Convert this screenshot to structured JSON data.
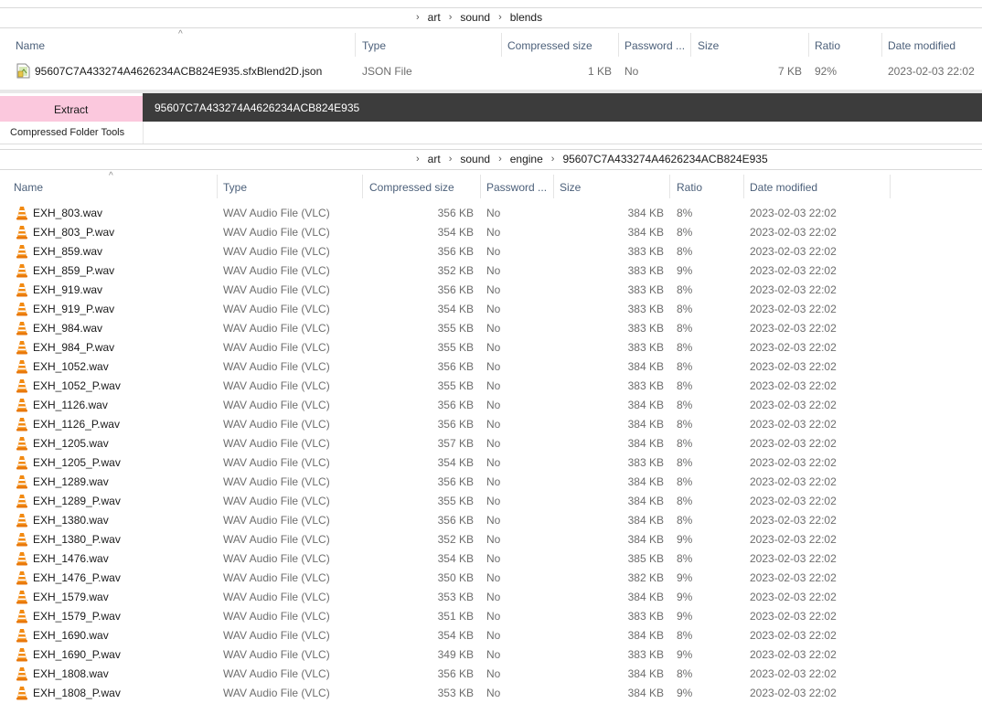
{
  "top_pane": {
    "breadcrumb": [
      "art",
      "sound",
      "blends"
    ],
    "columns": [
      "Name",
      "Type",
      "Compressed size",
      "Password ...",
      "Size",
      "Ratio",
      "Date modified"
    ],
    "file": {
      "name": "95607C7A433274A4626234ACB824E935.sfxBlend2D.json",
      "type": "JSON File",
      "compressed": "1 KB",
      "password": "No",
      "size": "7 KB",
      "ratio": "92%",
      "date": "2023-02-03 22:02",
      "icon": "json-file-icon"
    }
  },
  "ribbon": {
    "extract_tab": "Extract",
    "tools_label": "Compressed Folder Tools",
    "title": "95607C7A433274A4626234ACB824E935",
    "extract_color": "#fbc8dd",
    "title_bar_color": "#3c3c3c"
  },
  "bottom_pane": {
    "breadcrumb": [
      "art",
      "sound",
      "engine",
      "95607C7A433274A4626234ACB824E935"
    ],
    "columns": [
      "Name",
      "Type",
      "Compressed size",
      "Password ...",
      "Size",
      "Ratio",
      "Date modified"
    ],
    "file_icon": "vlc-cone-icon",
    "files": [
      {
        "name": "EXH_803.wav",
        "type": "WAV Audio File (VLC)",
        "compressed": "356 KB",
        "password": "No",
        "size": "384 KB",
        "ratio": "8%",
        "date": "2023-02-03 22:02"
      },
      {
        "name": "EXH_803_P.wav",
        "type": "WAV Audio File (VLC)",
        "compressed": "354 KB",
        "password": "No",
        "size": "384 KB",
        "ratio": "8%",
        "date": "2023-02-03 22:02"
      },
      {
        "name": "EXH_859.wav",
        "type": "WAV Audio File (VLC)",
        "compressed": "356 KB",
        "password": "No",
        "size": "383 KB",
        "ratio": "8%",
        "date": "2023-02-03 22:02"
      },
      {
        "name": "EXH_859_P.wav",
        "type": "WAV Audio File (VLC)",
        "compressed": "352 KB",
        "password": "No",
        "size": "383 KB",
        "ratio": "9%",
        "date": "2023-02-03 22:02"
      },
      {
        "name": "EXH_919.wav",
        "type": "WAV Audio File (VLC)",
        "compressed": "356 KB",
        "password": "No",
        "size": "383 KB",
        "ratio": "8%",
        "date": "2023-02-03 22:02"
      },
      {
        "name": "EXH_919_P.wav",
        "type": "WAV Audio File (VLC)",
        "compressed": "354 KB",
        "password": "No",
        "size": "383 KB",
        "ratio": "8%",
        "date": "2023-02-03 22:02"
      },
      {
        "name": "EXH_984.wav",
        "type": "WAV Audio File (VLC)",
        "compressed": "355 KB",
        "password": "No",
        "size": "383 KB",
        "ratio": "8%",
        "date": "2023-02-03 22:02"
      },
      {
        "name": "EXH_984_P.wav",
        "type": "WAV Audio File (VLC)",
        "compressed": "355 KB",
        "password": "No",
        "size": "383 KB",
        "ratio": "8%",
        "date": "2023-02-03 22:02"
      },
      {
        "name": "EXH_1052.wav",
        "type": "WAV Audio File (VLC)",
        "compressed": "356 KB",
        "password": "No",
        "size": "384 KB",
        "ratio": "8%",
        "date": "2023-02-03 22:02"
      },
      {
        "name": "EXH_1052_P.wav",
        "type": "WAV Audio File (VLC)",
        "compressed": "355 KB",
        "password": "No",
        "size": "383 KB",
        "ratio": "8%",
        "date": "2023-02-03 22:02"
      },
      {
        "name": "EXH_1126.wav",
        "type": "WAV Audio File (VLC)",
        "compressed": "356 KB",
        "password": "No",
        "size": "384 KB",
        "ratio": "8%",
        "date": "2023-02-03 22:02"
      },
      {
        "name": "EXH_1126_P.wav",
        "type": "WAV Audio File (VLC)",
        "compressed": "356 KB",
        "password": "No",
        "size": "384 KB",
        "ratio": "8%",
        "date": "2023-02-03 22:02"
      },
      {
        "name": "EXH_1205.wav",
        "type": "WAV Audio File (VLC)",
        "compressed": "357 KB",
        "password": "No",
        "size": "384 KB",
        "ratio": "8%",
        "date": "2023-02-03 22:02"
      },
      {
        "name": "EXH_1205_P.wav",
        "type": "WAV Audio File (VLC)",
        "compressed": "354 KB",
        "password": "No",
        "size": "383 KB",
        "ratio": "8%",
        "date": "2023-02-03 22:02"
      },
      {
        "name": "EXH_1289.wav",
        "type": "WAV Audio File (VLC)",
        "compressed": "356 KB",
        "password": "No",
        "size": "384 KB",
        "ratio": "8%",
        "date": "2023-02-03 22:02"
      },
      {
        "name": "EXH_1289_P.wav",
        "type": "WAV Audio File (VLC)",
        "compressed": "355 KB",
        "password": "No",
        "size": "384 KB",
        "ratio": "8%",
        "date": "2023-02-03 22:02"
      },
      {
        "name": "EXH_1380.wav",
        "type": "WAV Audio File (VLC)",
        "compressed": "356 KB",
        "password": "No",
        "size": "384 KB",
        "ratio": "8%",
        "date": "2023-02-03 22:02"
      },
      {
        "name": "EXH_1380_P.wav",
        "type": "WAV Audio File (VLC)",
        "compressed": "352 KB",
        "password": "No",
        "size": "384 KB",
        "ratio": "9%",
        "date": "2023-02-03 22:02"
      },
      {
        "name": "EXH_1476.wav",
        "type": "WAV Audio File (VLC)",
        "compressed": "354 KB",
        "password": "No",
        "size": "385 KB",
        "ratio": "8%",
        "date": "2023-02-03 22:02"
      },
      {
        "name": "EXH_1476_P.wav",
        "type": "WAV Audio File (VLC)",
        "compressed": "350 KB",
        "password": "No",
        "size": "382 KB",
        "ratio": "9%",
        "date": "2023-02-03 22:02"
      },
      {
        "name": "EXH_1579.wav",
        "type": "WAV Audio File (VLC)",
        "compressed": "353 KB",
        "password": "No",
        "size": "384 KB",
        "ratio": "9%",
        "date": "2023-02-03 22:02"
      },
      {
        "name": "EXH_1579_P.wav",
        "type": "WAV Audio File (VLC)",
        "compressed": "351 KB",
        "password": "No",
        "size": "383 KB",
        "ratio": "9%",
        "date": "2023-02-03 22:02"
      },
      {
        "name": "EXH_1690.wav",
        "type": "WAV Audio File (VLC)",
        "compressed": "354 KB",
        "password": "No",
        "size": "384 KB",
        "ratio": "8%",
        "date": "2023-02-03 22:02"
      },
      {
        "name": "EXH_1690_P.wav",
        "type": "WAV Audio File (VLC)",
        "compressed": "349 KB",
        "password": "No",
        "size": "383 KB",
        "ratio": "9%",
        "date": "2023-02-03 22:02"
      },
      {
        "name": "EXH_1808.wav",
        "type": "WAV Audio File (VLC)",
        "compressed": "356 KB",
        "password": "No",
        "size": "384 KB",
        "ratio": "8%",
        "date": "2023-02-03 22:02"
      },
      {
        "name": "EXH_1808_P.wav",
        "type": "WAV Audio File (VLC)",
        "compressed": "353 KB",
        "password": "No",
        "size": "384 KB",
        "ratio": "9%",
        "date": "2023-02-03 22:02"
      }
    ]
  }
}
